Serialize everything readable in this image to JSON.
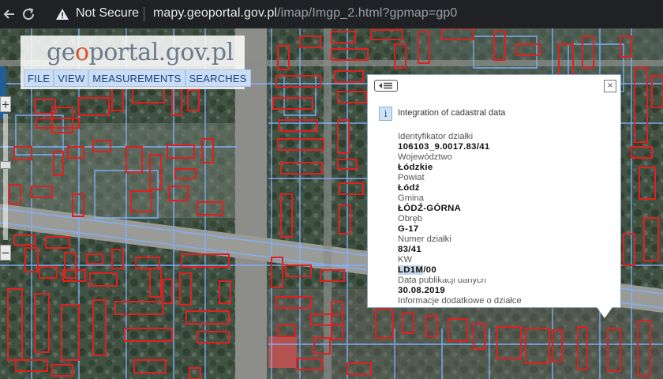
{
  "browser": {
    "security_label": "Not Secure",
    "url_host": "mapy.geoportal.gov.pl",
    "url_path": "/imap/Imgp_2.html?gpmap=gp0",
    "icons": {
      "back": "back-arrow-icon",
      "reload": "reload-icon",
      "warning": "warning-triangle-icon"
    }
  },
  "logo": {
    "text_pre": "ge",
    "text_o": "o",
    "text_post": "portal.gov.pl"
  },
  "menu": [
    {
      "label": "FILE"
    },
    {
      "label": "VIEW"
    },
    {
      "label": "MEASUREMENTS"
    },
    {
      "label": "SEARCHES"
    }
  ],
  "zoom": {
    "plus": "+",
    "minus": "−"
  },
  "popup": {
    "title": "Integration of cadastral data",
    "fields": [
      {
        "label": "Identyfikator działki",
        "value": "106103_9.0017.83/41"
      },
      {
        "label": "Województwo",
        "value": "Łódzkie"
      },
      {
        "label": "Powiat",
        "value": "Łódź"
      },
      {
        "label": "Gmina",
        "value": "ŁÓDŹ-GÓRNA"
      },
      {
        "label": "Obręb",
        "value": "G-17"
      },
      {
        "label": "Numer działki",
        "value": "83/41"
      },
      {
        "label": "KW",
        "value": "LD1M/00",
        "value_highlight": "LD1M"
      },
      {
        "label": "Data publikacji danych",
        "value": "30.08.2019"
      },
      {
        "label": "Informacje dodatkowe o działce",
        "value": ""
      }
    ]
  },
  "colors": {
    "parcel_outline": "#e0201e",
    "plot_line": "#7fb2ff",
    "menu_bg": "#c9def6",
    "browser_bg": "#202124"
  }
}
